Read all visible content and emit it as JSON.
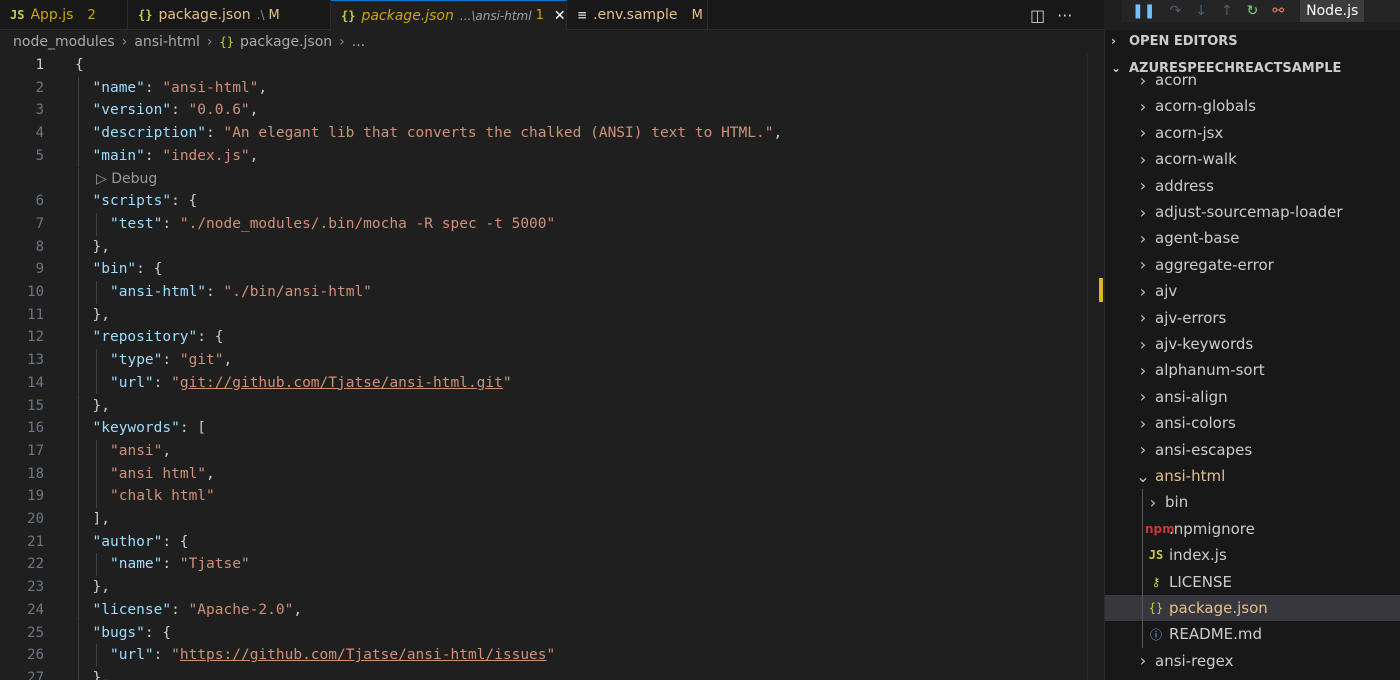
{
  "tabs": [
    {
      "icon": "JS",
      "icon_name": "javascript-file-icon",
      "name": "App.js",
      "desc": "",
      "badge": "2",
      "active": false,
      "close": false
    },
    {
      "icon": "{}",
      "icon_name": "json-file-icon",
      "name": "package.json",
      "desc": ".\\",
      "badge": "M",
      "active": false,
      "close": false
    },
    {
      "icon": "{}",
      "icon_name": "json-file-icon",
      "name": "package.json",
      "desc": "...\\ansi-html",
      "badge": "1",
      "active": true,
      "close": true
    },
    {
      "icon": "≡",
      "icon_name": "text-file-icon",
      "name": ".env.sample",
      "desc": "",
      "badge": "M",
      "active": false,
      "close": false
    }
  ],
  "tab_actions": {
    "split": "◫",
    "more": "···"
  },
  "debug_toolbar": {
    "pause": "❚❚",
    "step_over": "↷",
    "step_into": "↓",
    "step_out": "↑",
    "restart": "↻",
    "disconnect": "⚯",
    "config": "Node.js"
  },
  "breadcrumb": [
    "node_modules",
    "ansi-html",
    "package.json",
    "..."
  ],
  "editor": {
    "current_line": 1,
    "code_lens_after_line": 5,
    "code_lens_label": "▷ Debug",
    "lines": [
      {
        "n": 1,
        "indent": 0,
        "tokens": [
          {
            "t": "p",
            "v": "{"
          }
        ]
      },
      {
        "n": 2,
        "indent": 1,
        "tokens": [
          {
            "t": "k",
            "v": "\"name\""
          },
          {
            "t": "p",
            "v": ": "
          },
          {
            "t": "s",
            "v": "\"ansi-html\""
          },
          {
            "t": "p",
            "v": ","
          }
        ]
      },
      {
        "n": 3,
        "indent": 1,
        "tokens": [
          {
            "t": "k",
            "v": "\"version\""
          },
          {
            "t": "p",
            "v": ": "
          },
          {
            "t": "s",
            "v": "\"0.0.6\""
          },
          {
            "t": "p",
            "v": ","
          }
        ]
      },
      {
        "n": 4,
        "indent": 1,
        "tokens": [
          {
            "t": "k",
            "v": "\"description\""
          },
          {
            "t": "p",
            "v": ": "
          },
          {
            "t": "s",
            "v": "\"An elegant lib that converts the chalked (ANSI) text to HTML.\""
          },
          {
            "t": "p",
            "v": ","
          }
        ]
      },
      {
        "n": 5,
        "indent": 1,
        "tokens": [
          {
            "t": "k",
            "v": "\"main\""
          },
          {
            "t": "p",
            "v": ": "
          },
          {
            "t": "s",
            "v": "\"index.js\""
          },
          {
            "t": "p",
            "v": ","
          }
        ]
      },
      {
        "n": 6,
        "indent": 1,
        "tokens": [
          {
            "t": "k",
            "v": "\"scripts\""
          },
          {
            "t": "p",
            "v": ": {"
          }
        ]
      },
      {
        "n": 7,
        "indent": 2,
        "tokens": [
          {
            "t": "k",
            "v": "\"test\""
          },
          {
            "t": "p",
            "v": ": "
          },
          {
            "t": "s",
            "v": "\"./node_modules/.bin/mocha -R spec -t 5000\""
          }
        ]
      },
      {
        "n": 8,
        "indent": 1,
        "tokens": [
          {
            "t": "p",
            "v": "},"
          }
        ]
      },
      {
        "n": 9,
        "indent": 1,
        "tokens": [
          {
            "t": "k",
            "v": "\"bin\""
          },
          {
            "t": "p",
            "v": ": {"
          }
        ]
      },
      {
        "n": 10,
        "indent": 2,
        "tokens": [
          {
            "t": "k",
            "v": "\"ansi-html\""
          },
          {
            "t": "p",
            "v": ": "
          },
          {
            "t": "s",
            "v": "\"./bin/ansi-html\""
          }
        ]
      },
      {
        "n": 11,
        "indent": 1,
        "tokens": [
          {
            "t": "p",
            "v": "},"
          }
        ]
      },
      {
        "n": 12,
        "indent": 1,
        "tokens": [
          {
            "t": "k",
            "v": "\"repository\""
          },
          {
            "t": "p",
            "v": ": {"
          }
        ]
      },
      {
        "n": 13,
        "indent": 2,
        "tokens": [
          {
            "t": "k",
            "v": "\"type\""
          },
          {
            "t": "p",
            "v": ": "
          },
          {
            "t": "s",
            "v": "\"git\""
          },
          {
            "t": "p",
            "v": ","
          }
        ]
      },
      {
        "n": 14,
        "indent": 2,
        "tokens": [
          {
            "t": "k",
            "v": "\"url\""
          },
          {
            "t": "p",
            "v": ": "
          },
          {
            "t": "s",
            "v": "\""
          },
          {
            "t": "su",
            "v": "git://github.com/Tjatse/ansi-html.git"
          },
          {
            "t": "s",
            "v": "\""
          }
        ]
      },
      {
        "n": 15,
        "indent": 1,
        "tokens": [
          {
            "t": "p",
            "v": "},"
          }
        ]
      },
      {
        "n": 16,
        "indent": 1,
        "tokens": [
          {
            "t": "k",
            "v": "\"keywords\""
          },
          {
            "t": "p",
            "v": ": ["
          }
        ]
      },
      {
        "n": 17,
        "indent": 2,
        "tokens": [
          {
            "t": "s",
            "v": "\"ansi\""
          },
          {
            "t": "p",
            "v": ","
          }
        ]
      },
      {
        "n": 18,
        "indent": 2,
        "tokens": [
          {
            "t": "s",
            "v": "\"ansi html\""
          },
          {
            "t": "p",
            "v": ","
          }
        ]
      },
      {
        "n": 19,
        "indent": 2,
        "tokens": [
          {
            "t": "s",
            "v": "\"chalk html\""
          }
        ]
      },
      {
        "n": 20,
        "indent": 1,
        "tokens": [
          {
            "t": "p",
            "v": "],"
          }
        ]
      },
      {
        "n": 21,
        "indent": 1,
        "tokens": [
          {
            "t": "k",
            "v": "\"author\""
          },
          {
            "t": "p",
            "v": ": {"
          }
        ]
      },
      {
        "n": 22,
        "indent": 2,
        "tokens": [
          {
            "t": "k",
            "v": "\"name\""
          },
          {
            "t": "p",
            "v": ": "
          },
          {
            "t": "s",
            "v": "\"Tjatse\""
          }
        ]
      },
      {
        "n": 23,
        "indent": 1,
        "tokens": [
          {
            "t": "p",
            "v": "},"
          }
        ]
      },
      {
        "n": 24,
        "indent": 1,
        "tokens": [
          {
            "t": "k",
            "v": "\"license\""
          },
          {
            "t": "p",
            "v": ": "
          },
          {
            "t": "s",
            "v": "\"Apache-2.0\""
          },
          {
            "t": "p",
            "v": ","
          }
        ]
      },
      {
        "n": 25,
        "indent": 1,
        "tokens": [
          {
            "t": "k",
            "v": "\"bugs\""
          },
          {
            "t": "p",
            "v": ": {"
          }
        ]
      },
      {
        "n": 26,
        "indent": 2,
        "tokens": [
          {
            "t": "k",
            "v": "\"url\""
          },
          {
            "t": "p",
            "v": ": "
          },
          {
            "t": "s",
            "v": "\""
          },
          {
            "t": "su",
            "v": "https://github.com/Tjatse/ansi-html/issues"
          },
          {
            "t": "s",
            "v": "\""
          }
        ]
      },
      {
        "n": 27,
        "indent": 1,
        "tokens": [
          {
            "t": "p",
            "v": "},"
          }
        ]
      }
    ]
  },
  "explorer": {
    "open_editors_label": "OPEN EDITORS",
    "project_label": "AZURESPEECHREACTSAMPLE",
    "items": [
      {
        "label": "acorn",
        "kind": "folder",
        "depth": 0,
        "expanded": false
      },
      {
        "label": "acorn-globals",
        "kind": "folder",
        "depth": 0,
        "expanded": false
      },
      {
        "label": "acorn-jsx",
        "kind": "folder",
        "depth": 0,
        "expanded": false
      },
      {
        "label": "acorn-walk",
        "kind": "folder",
        "depth": 0,
        "expanded": false
      },
      {
        "label": "address",
        "kind": "folder",
        "depth": 0,
        "expanded": false
      },
      {
        "label": "adjust-sourcemap-loader",
        "kind": "folder",
        "depth": 0,
        "expanded": false
      },
      {
        "label": "agent-base",
        "kind": "folder",
        "depth": 0,
        "expanded": false
      },
      {
        "label": "aggregate-error",
        "kind": "folder",
        "depth": 0,
        "expanded": false
      },
      {
        "label": "ajv",
        "kind": "folder",
        "depth": 0,
        "expanded": false
      },
      {
        "label": "ajv-errors",
        "kind": "folder",
        "depth": 0,
        "expanded": false
      },
      {
        "label": "ajv-keywords",
        "kind": "folder",
        "depth": 0,
        "expanded": false
      },
      {
        "label": "alphanum-sort",
        "kind": "folder",
        "depth": 0,
        "expanded": false
      },
      {
        "label": "ansi-align",
        "kind": "folder",
        "depth": 0,
        "expanded": false
      },
      {
        "label": "ansi-colors",
        "kind": "folder",
        "depth": 0,
        "expanded": false
      },
      {
        "label": "ansi-escapes",
        "kind": "folder",
        "depth": 0,
        "expanded": false
      },
      {
        "label": "ansi-html",
        "kind": "folder",
        "depth": 0,
        "expanded": true,
        "modified": true
      },
      {
        "label": "bin",
        "kind": "folder",
        "depth": 1,
        "expanded": false
      },
      {
        "label": ".npmignore",
        "kind": "npm",
        "depth": 1
      },
      {
        "label": "index.js",
        "kind": "js",
        "depth": 1
      },
      {
        "label": "LICENSE",
        "kind": "license",
        "depth": 1
      },
      {
        "label": "package.json",
        "kind": "json",
        "depth": 1,
        "selected": true,
        "modified": true
      },
      {
        "label": "README.md",
        "kind": "info",
        "depth": 1
      },
      {
        "label": "ansi-regex",
        "kind": "folder",
        "depth": 0,
        "expanded": false
      }
    ]
  },
  "icons": {
    "folder_closed": "›",
    "folder_open": "⌄",
    "js": "JS",
    "json": "{}",
    "npm": "npm",
    "license": "⚷",
    "info": "ⓘ"
  },
  "colors": {
    "key": "#9cdcfe",
    "string": "#ce9178",
    "modified": "#e2c08d",
    "accent": "#0078d4"
  }
}
